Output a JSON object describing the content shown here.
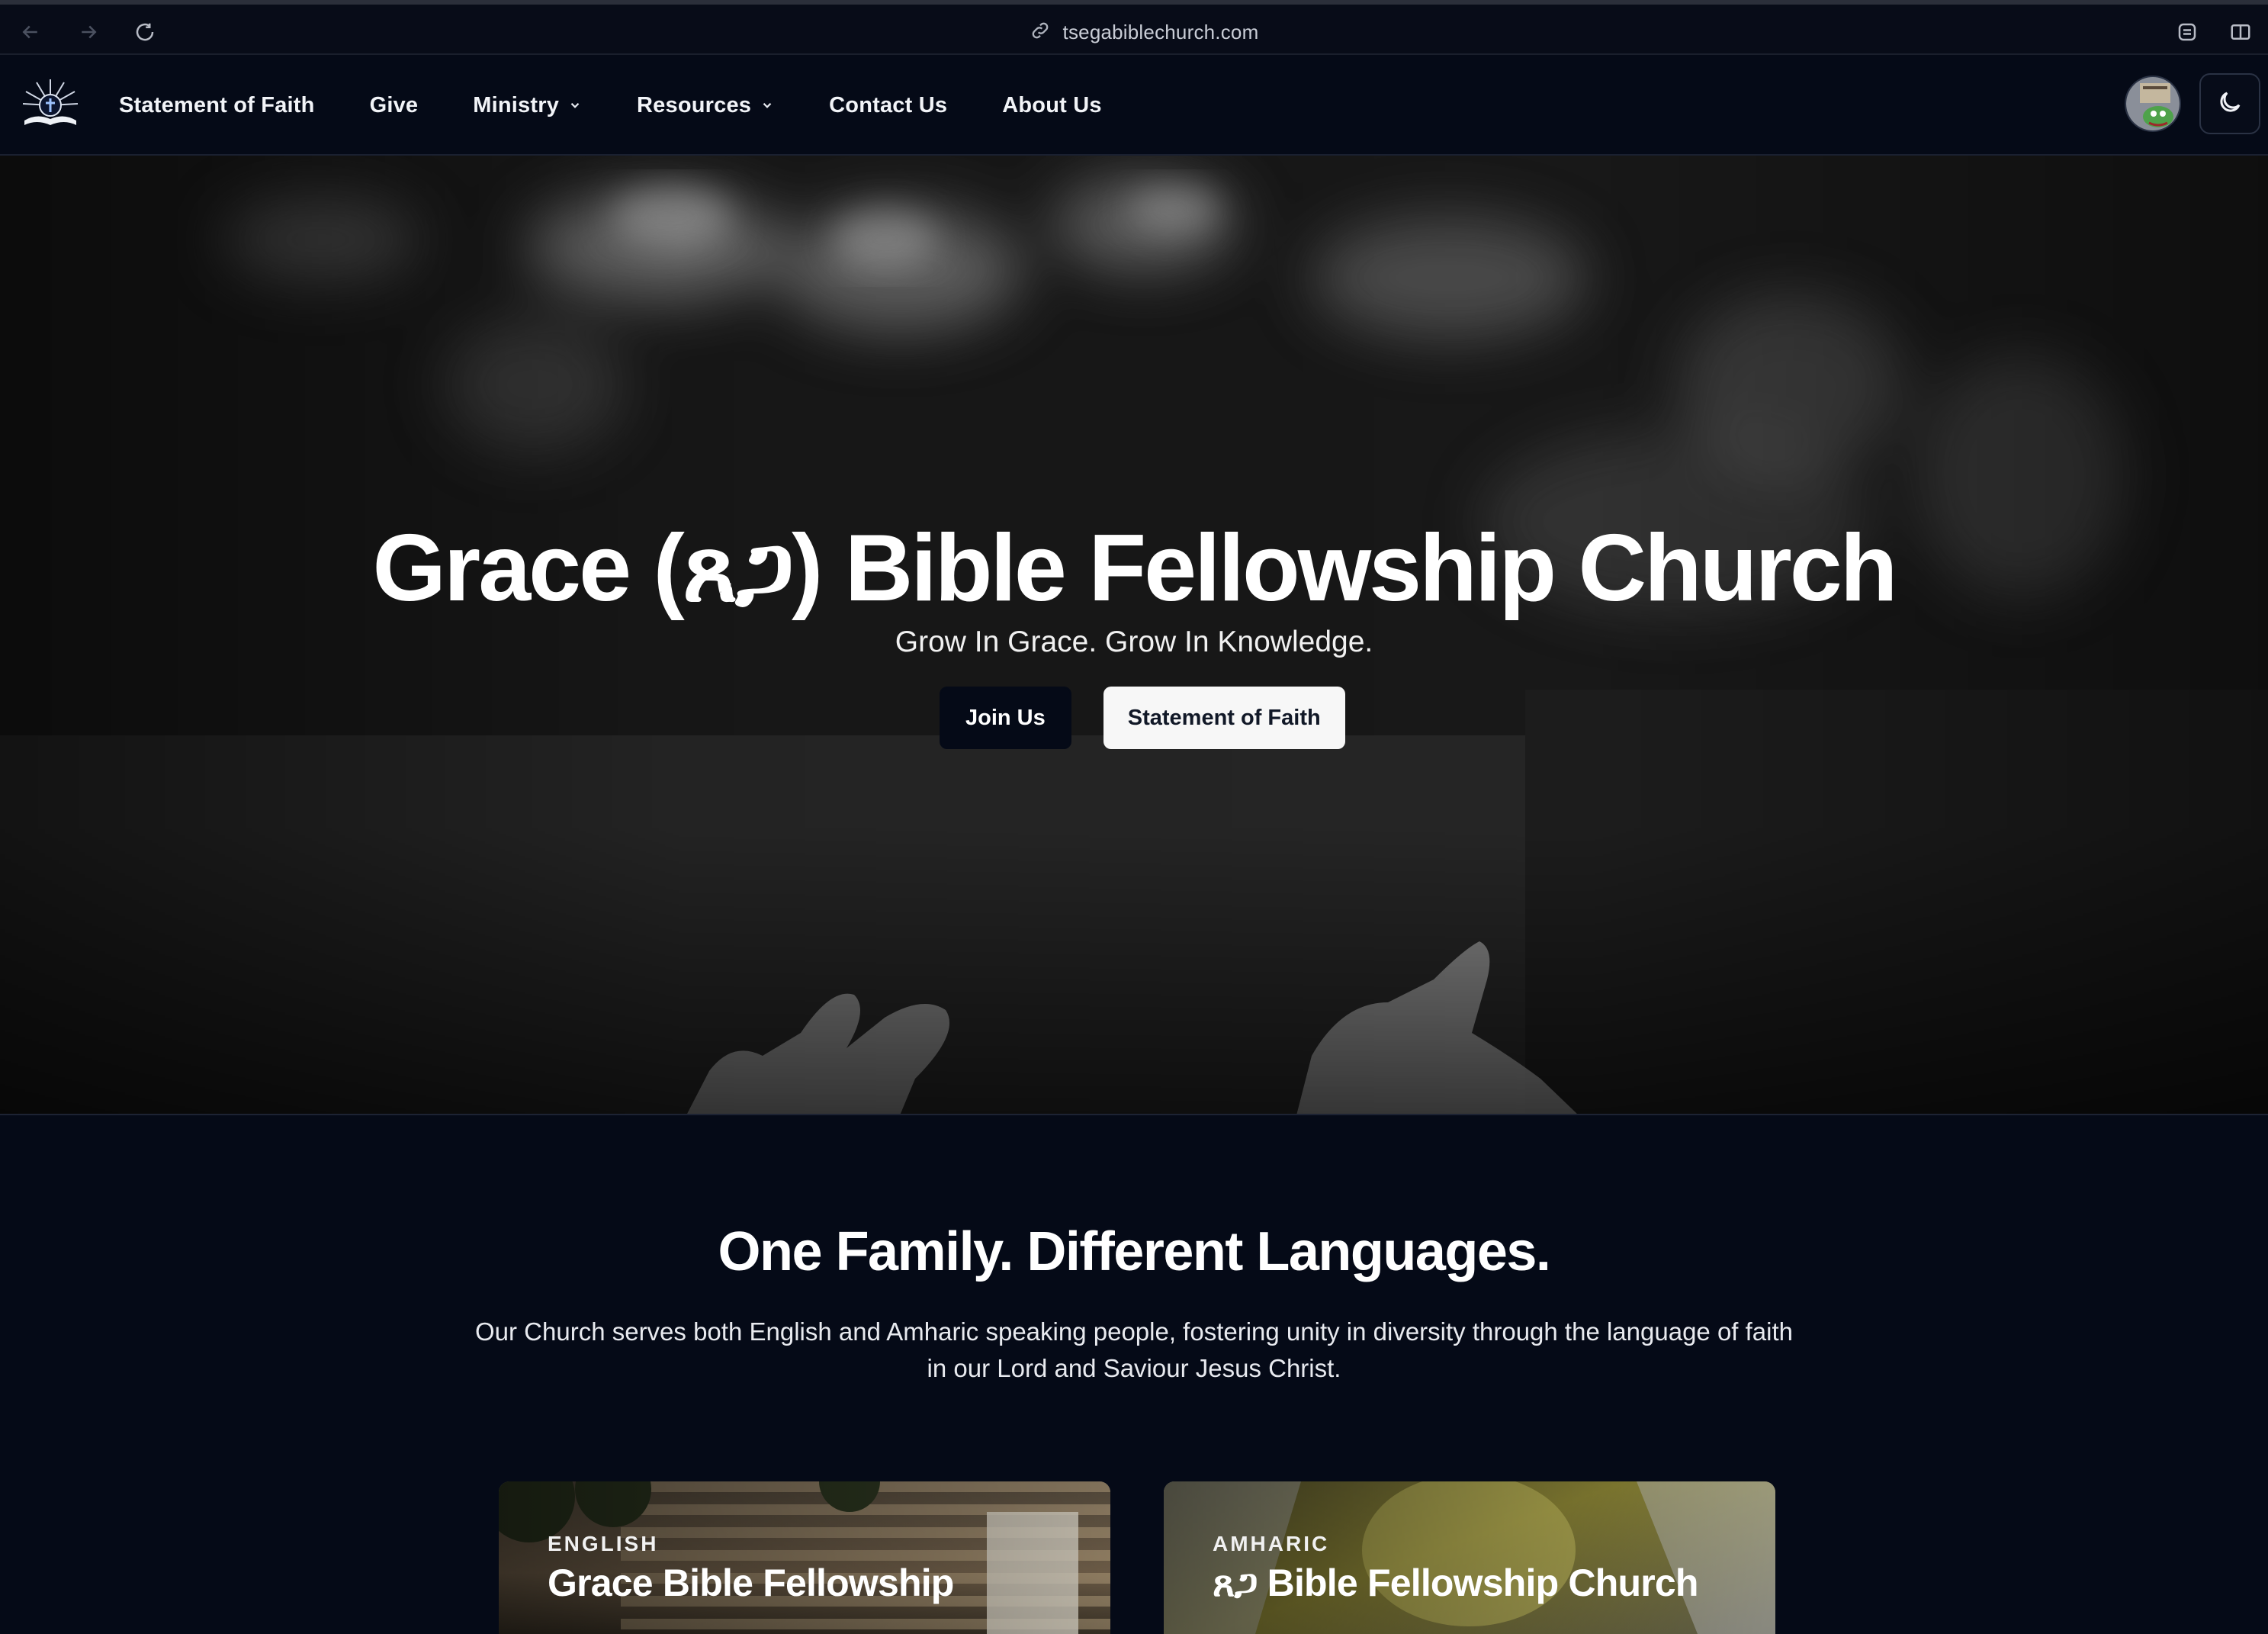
{
  "browser": {
    "url": "tsegabiblechurch.com",
    "icons": [
      "back-icon",
      "forward-icon",
      "reload-icon",
      "link-icon",
      "extensions-icon",
      "sidebar-icon"
    ]
  },
  "nav": {
    "items": [
      {
        "label": "Statement of Faith"
      },
      {
        "label": "Give"
      },
      {
        "label": "Ministry",
        "dropdown": true
      },
      {
        "label": "Resources",
        "dropdown": true
      },
      {
        "label": "Contact Us"
      },
      {
        "label": "About Us"
      }
    ]
  },
  "hero": {
    "title": "Grace (ጸጋ) Bible Fellowship Church",
    "subtitle": "Grow In Grace. Grow In Knowledge.",
    "primary_button": "Join Us",
    "secondary_button": "Statement of Faith"
  },
  "languages": {
    "title": "One Family. Different Languages.",
    "description": "Our Church serves both English and Amharic speaking people, fostering unity in diversity through the language of faith in our Lord and Saviour Jesus Christ.",
    "cards": [
      {
        "kicker": "ENGLISH",
        "title": "Grace Bible Fellowship"
      },
      {
        "kicker": "AMHARIC",
        "title": "ጸጋ Bible Fellowship Church"
      }
    ]
  },
  "colors": {
    "background": "#050a17",
    "text": "#ffffff",
    "button_dark": "#050a17",
    "button_light": "#f7f7f7"
  }
}
